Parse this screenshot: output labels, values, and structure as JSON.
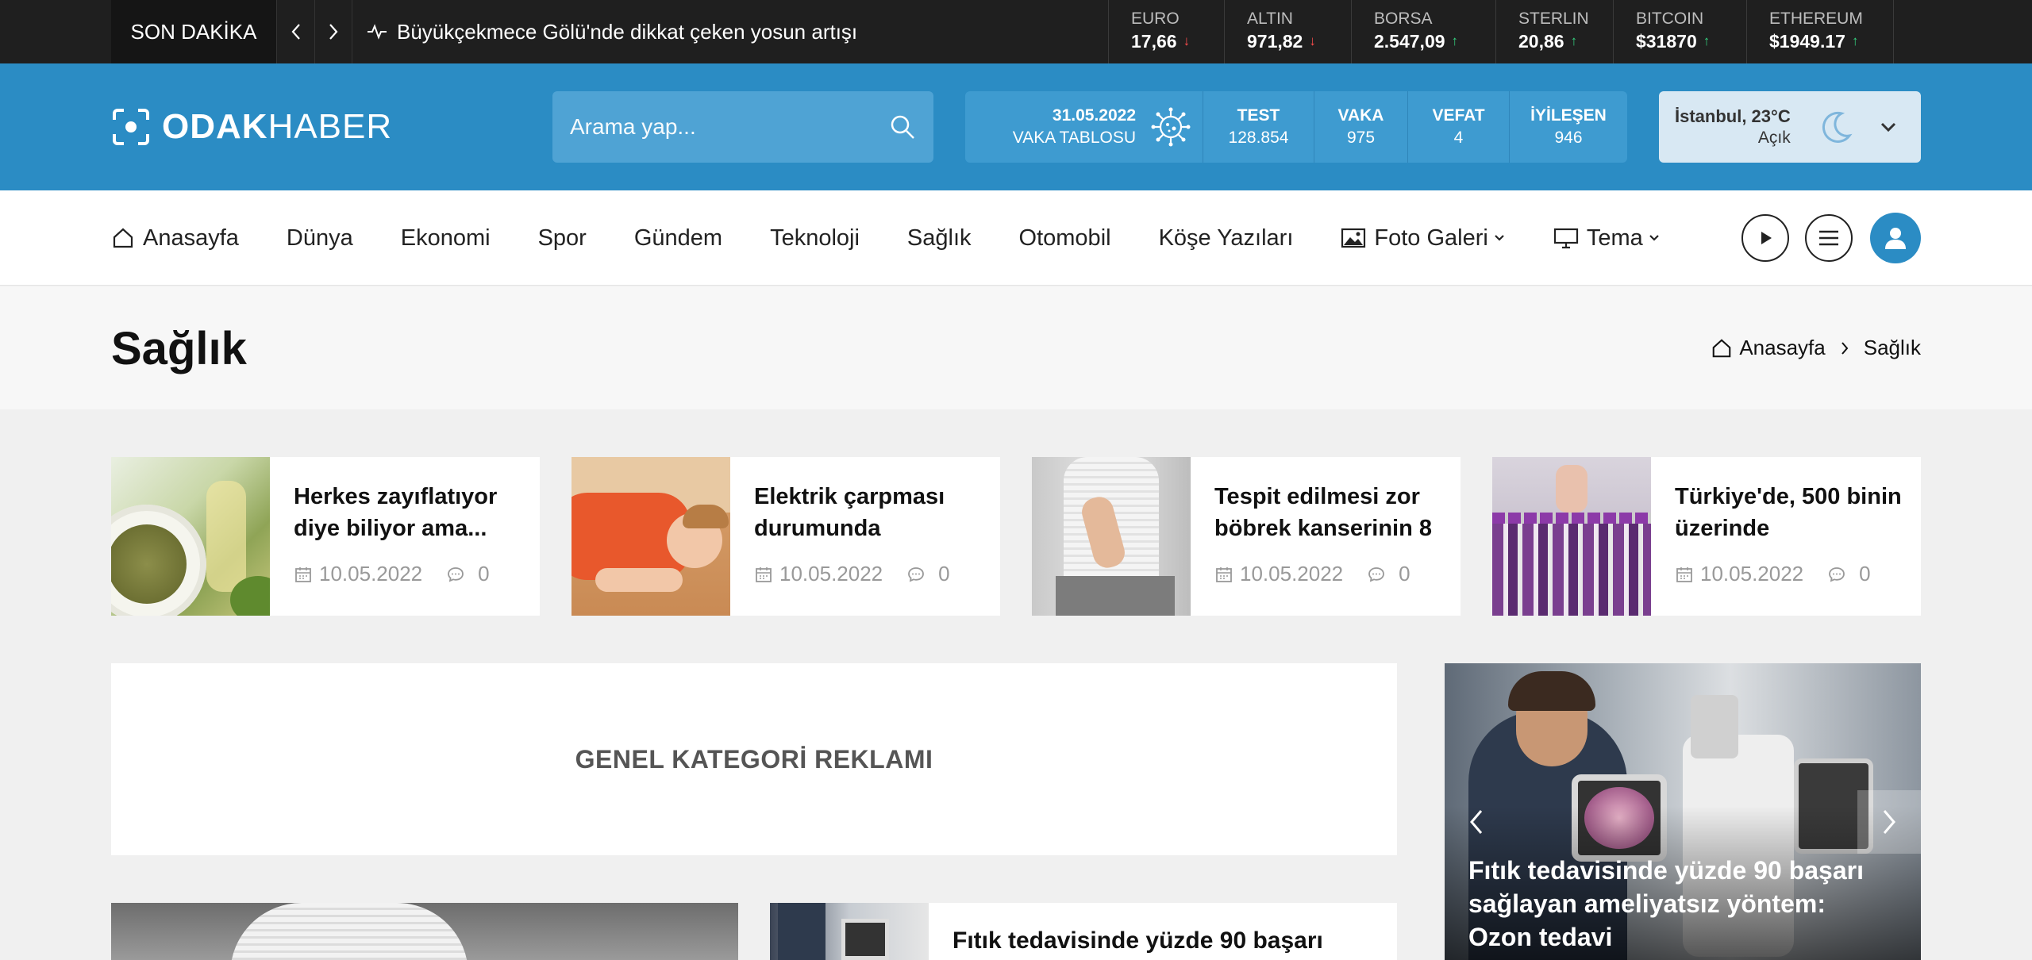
{
  "topbar": {
    "breaking_label": "SON DAKİKA",
    "breaking_text": "Büyükçekmece Gölü'nde dikkat çeken yosun artışı",
    "currencies": [
      {
        "name": "EURO",
        "value": "17,66",
        "trend": "down"
      },
      {
        "name": "ALTIN",
        "value": "971,82",
        "trend": "down"
      },
      {
        "name": "BORSA",
        "value": "2.547,09",
        "trend": "up"
      },
      {
        "name": "STERLIN",
        "value": "20,86",
        "trend": "up"
      },
      {
        "name": "BITCOIN",
        "value": "$31870",
        "trend": "up"
      },
      {
        "name": "ETHEREUM",
        "value": "$1949.17",
        "trend": "up"
      }
    ]
  },
  "header": {
    "logo_bold": "ODAK",
    "logo_light": "HABER",
    "search_placeholder": "Arama yap...",
    "covid": {
      "date": "31.05.2022",
      "table_label": "VAKA TABLOSU",
      "stats": [
        {
          "label": "TEST",
          "value": "128.854"
        },
        {
          "label": "VAKA",
          "value": "975"
        },
        {
          "label": "VEFAT",
          "value": "4"
        },
        {
          "label": "İYİLEŞEN",
          "value": "946"
        }
      ]
    },
    "weather": {
      "city": "İstanbul, 23°C",
      "condition": "Açık",
      "icon": "moon-icon"
    }
  },
  "nav": {
    "items": [
      {
        "label": "Anasayfa",
        "icon": "home-icon"
      },
      {
        "label": "Dünya"
      },
      {
        "label": "Ekonomi"
      },
      {
        "label": "Spor"
      },
      {
        "label": "Gündem"
      },
      {
        "label": "Teknoloji"
      },
      {
        "label": "Sağlık"
      },
      {
        "label": "Otomobil"
      },
      {
        "label": "Köşe Yazıları"
      },
      {
        "label": "Foto Galeri",
        "icon": "image-icon",
        "dropdown": true
      },
      {
        "label": "Tema",
        "icon": "monitor-icon",
        "dropdown": true
      }
    ]
  },
  "page": {
    "title": "Sağlık",
    "breadcrumb": {
      "home": "Anasayfa",
      "current": "Sağlık"
    }
  },
  "cards": [
    {
      "title": "Herkes zayıflatıyor diye biliyor ama...",
      "date": "10.05.2022",
      "comments": "0"
    },
    {
      "title": "Elektrik çarpması durumunda",
      "date": "10.05.2022",
      "comments": "0"
    },
    {
      "title": "Tespit edilmesi zor böbrek kanserinin 8",
      "date": "10.05.2022",
      "comments": "0"
    },
    {
      "title": "Türkiye'de, 500 binin üzerinde",
      "date": "10.05.2022",
      "comments": "0"
    }
  ],
  "ad": {
    "label": "GENEL KATEGORİ REKLAMI"
  },
  "slider": {
    "caption": "Fıtık tedavisinde yüzde 90 başarı sağlayan ameliyatsız yöntem: Ozon tedavi"
  },
  "bottom": {
    "small_title": "Fıtık tedavisinde yüzde 90 başarı"
  },
  "colors": {
    "brand": "#2b8cc4",
    "topbar": "#1f1f1f",
    "up": "#35d07f",
    "down": "#ff4d4d"
  }
}
